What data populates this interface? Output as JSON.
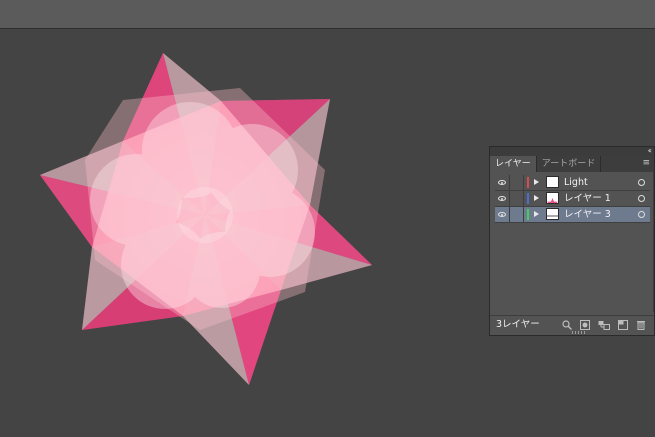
{
  "layers_panel": {
    "tabs": [
      {
        "label": "レイヤー",
        "active": true
      },
      {
        "label": "アートボード",
        "active": false
      }
    ],
    "collapse_glyph": "‹‹",
    "menu_glyph": "≡",
    "layers": [
      {
        "name": "Light",
        "color": "#d94b4b",
        "visible": true,
        "selected": false,
        "thumbnail": "blank"
      },
      {
        "name": "レイヤー 1",
        "color": "#4a6fd1",
        "visible": true,
        "selected": false,
        "thumbnail": "star"
      },
      {
        "name": "レイヤー 3",
        "color": "#3fcf5a",
        "visible": true,
        "selected": true,
        "thumbnail": "lines"
      }
    ],
    "footer": {
      "layer_count": "3レイヤー",
      "buttons": [
        "locate-object-icon",
        "make-clipping-mask-icon",
        "new-sublayer-icon",
        "new-layer-icon",
        "trash-icon"
      ]
    }
  },
  "artwork": {
    "description_colors": {
      "canvas": "#444444",
      "hot_pink": "#e0447c",
      "light_pink": "#ffc6cf",
      "gray_facet": "#b9aeb0"
    }
  }
}
